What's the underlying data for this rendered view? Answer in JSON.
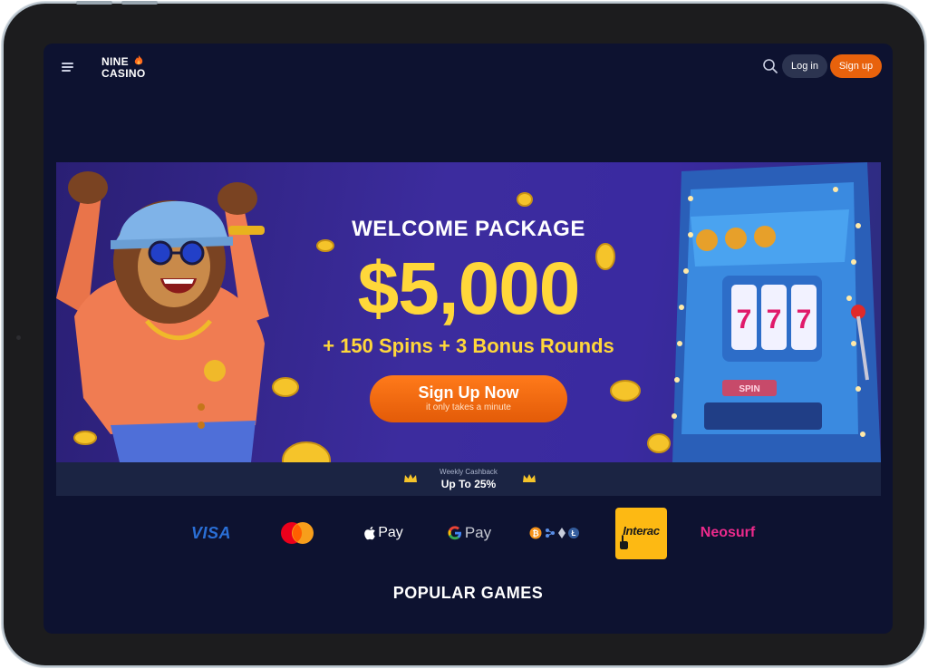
{
  "header": {
    "logo_line1": "NINE",
    "logo_line2": "CASINO",
    "login_label": "Log in",
    "signup_label": "Sign up"
  },
  "hero": {
    "title": "WELCOME PACKAGE",
    "amount": "$5,000",
    "extras": "+ 150 Spins + 3 Bonus Rounds",
    "cta_label": "Sign Up Now",
    "cta_sublabel": "it only takes a minute",
    "slot_symbol": "7",
    "spin_label": "SPIN"
  },
  "cashback": {
    "label": "Weekly Cashback",
    "value": "Up To 25%"
  },
  "payments": {
    "visa": "VISA",
    "apple_pay": "Pay",
    "google_pay": "Pay",
    "interac": "Interac",
    "neosurf": "Neosurf"
  },
  "sections": {
    "popular_games": "POPULAR GAMES"
  },
  "colors": {
    "accent_orange": "#e8620c",
    "gold": "#ffd73a",
    "background": "#0d1230",
    "hero_purple": "#3c2c9e"
  }
}
